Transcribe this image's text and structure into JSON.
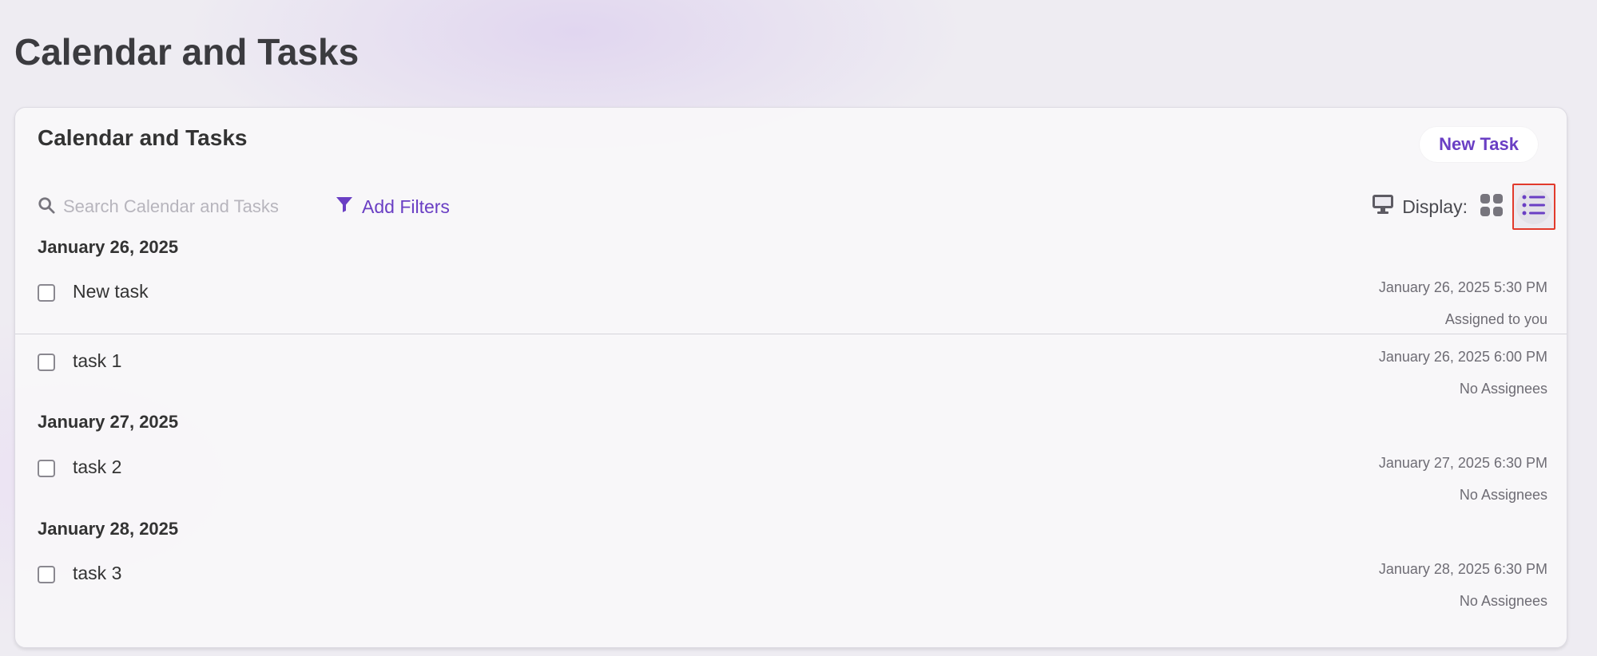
{
  "header": {
    "page_title": "Calendar and Tasks"
  },
  "card": {
    "title": "Calendar and Tasks",
    "new_task_label": "New Task"
  },
  "toolbar": {
    "search_placeholder": "Search Calendar and Tasks",
    "search_value": "",
    "add_filters_label": "Add Filters",
    "display_label": "Display:",
    "selected_view": "list"
  },
  "groups": [
    {
      "date": "January 26, 2025",
      "tasks": [
        {
          "name": "New task",
          "datetime": "January 26, 2025 5:30 PM",
          "assignee": "Assigned to you",
          "checked": false
        },
        {
          "name": "task 1",
          "datetime": "January 26, 2025 6:00 PM",
          "assignee": "No Assignees",
          "checked": false
        }
      ]
    },
    {
      "date": "January 27, 2025",
      "tasks": [
        {
          "name": "task 2",
          "datetime": "January 27, 2025 6:30 PM",
          "assignee": "No Assignees",
          "checked": false
        }
      ]
    },
    {
      "date": "January 28, 2025",
      "tasks": [
        {
          "name": "task 3",
          "datetime": "January 28, 2025 6:30 PM",
          "assignee": "No Assignees",
          "checked": false
        }
      ]
    }
  ],
  "colors": {
    "accent": "#6a3fc4",
    "highlight_border": "#e23a2c",
    "icon_gray": "#77757d"
  }
}
